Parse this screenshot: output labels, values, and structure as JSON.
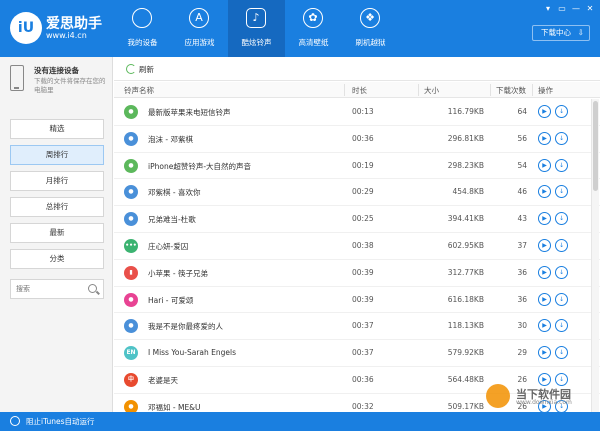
{
  "app": {
    "logo_mark": "iU",
    "name": "爱思助手",
    "url": "www.i4.cn"
  },
  "nav": [
    {
      "label": "我的设备",
      "icon": "apple-icon",
      "glyph": ""
    },
    {
      "label": "应用游戏",
      "icon": "app-store-icon",
      "glyph": "A"
    },
    {
      "label": "酷炫铃声",
      "icon": "music-note-icon",
      "glyph": "♪"
    },
    {
      "label": "高清壁纸",
      "icon": "flower-icon",
      "glyph": "✿"
    },
    {
      "label": "刷机越狱",
      "icon": "dropbox-icon",
      "glyph": "❖"
    }
  ],
  "window_controls": [
    "▾",
    "▭",
    "—",
    "✕"
  ],
  "download_center": {
    "label": "下载中心",
    "glyph": "⇩"
  },
  "device": {
    "title": "没有连接设备",
    "desc": "下载的文件将保存在您的电脑里"
  },
  "side_menu": [
    {
      "label": "精选"
    },
    {
      "label": "周排行"
    },
    {
      "label": "月排行"
    },
    {
      "label": "总排行"
    },
    {
      "label": "最新"
    },
    {
      "label": "分类"
    }
  ],
  "search": {
    "placeholder": "搜索"
  },
  "toolbar": {
    "refresh_label": "刷新"
  },
  "table": {
    "headers": {
      "name": "铃声名称",
      "duration": "时长",
      "size": "大小",
      "downloads": "下载次数",
      "actions": "操作"
    },
    "rows": [
      {
        "name": "最新版苹果来电短信铃声",
        "duration": "00:13",
        "size": "116.79KB",
        "downloads": "64",
        "icon_color": "#5cb85c",
        "icon_glyph": "●"
      },
      {
        "name": "泡沫 - 邓紫棋",
        "duration": "00:36",
        "size": "296.81KB",
        "downloads": "56",
        "icon_color": "#4a90d9",
        "icon_glyph": "●"
      },
      {
        "name": "iPhone超赞铃声-大自然的声音",
        "duration": "00:19",
        "size": "298.23KB",
        "downloads": "54",
        "icon_color": "#5cb85c",
        "icon_glyph": "●"
      },
      {
        "name": "邓紫棋 - 喜欢你",
        "duration": "00:29",
        "size": "454.8KB",
        "downloads": "46",
        "icon_color": "#4a90d9",
        "icon_glyph": "●"
      },
      {
        "name": "兄弟难当-杜歌",
        "duration": "00:25",
        "size": "394.41KB",
        "downloads": "43",
        "icon_color": "#4a90d9",
        "icon_glyph": "●"
      },
      {
        "name": "庄心妍-爱囚",
        "duration": "00:38",
        "size": "602.95KB",
        "downloads": "37",
        "icon_color": "#3cb371",
        "icon_glyph": "•••"
      },
      {
        "name": "小苹果 - 筷子兄弟",
        "duration": "00:39",
        "size": "312.77KB",
        "downloads": "36",
        "icon_color": "#e9504a",
        "icon_glyph": "▮"
      },
      {
        "name": "Hari - 可爱颂",
        "duration": "00:39",
        "size": "616.18KB",
        "downloads": "36",
        "icon_color": "#e84393",
        "icon_glyph": "●"
      },
      {
        "name": "我是不是你最疼爱的人",
        "duration": "00:37",
        "size": "118.13KB",
        "downloads": "30",
        "icon_color": "#4a90d9",
        "icon_glyph": "●"
      },
      {
        "name": "I Miss You-Sarah Engels",
        "duration": "00:37",
        "size": "579.92KB",
        "downloads": "29",
        "icon_color": "#4fc3c7",
        "icon_glyph": "EN"
      },
      {
        "name": "老婆是天",
        "duration": "00:36",
        "size": "564.48KB",
        "downloads": "26",
        "icon_color": "#e84a2f",
        "icon_glyph": "中"
      },
      {
        "name": "邓福如 - ME&U",
        "duration": "00:32",
        "size": "509.17KB",
        "downloads": "26",
        "icon_color": "#f29100",
        "icon_glyph": "●"
      }
    ]
  },
  "actions": {
    "play_glyph": "▶",
    "download_glyph": "↓"
  },
  "statusbar": {
    "label": "阻止iTunes自动运行"
  },
  "watermark": {
    "text": "当下软件园",
    "url": "www.downxia.com"
  }
}
